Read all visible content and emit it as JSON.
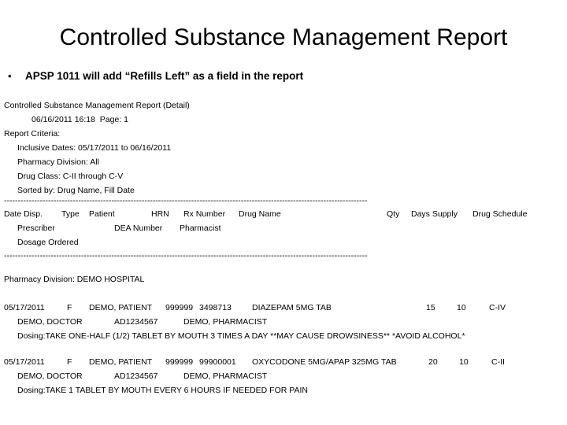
{
  "slide": {
    "title": "Controlled Substance Management Report",
    "bullet_mark": "•",
    "bullet_text": "APSP 1011 will add “Refills Left” as a field in the report"
  },
  "report": {
    "heading": "Controlled Substance Management Report (Detail)",
    "run_stamp": "06/16/2011 16:18  Page: 1",
    "criteria_label": "Report Criteria:",
    "criteria": [
      "Inclusive Dates: 05/17/2011 to 06/16/2011",
      "Pharmacy Division: All",
      "Drug Class: C-II through C-V",
      "Sorted by: Drug Name, Fill Date"
    ],
    "separator": "------------------------------------------------------------------------------------------------------------------------------------",
    "columns": {
      "date_disp": "Date Disp.",
      "type": "Type",
      "patient": "Patient",
      "hrn": "HRN",
      "rx_number": "Rx Number",
      "drug_name": "Drug Name",
      "qty": "Qty",
      "days_supply": "Days Supply",
      "drug_schedule": "Drug Schedule",
      "prescriber": "Prescriber",
      "dea_number": "DEA Number",
      "pharmacist": "Pharmacist",
      "dosage_ordered": "Dosage Ordered"
    },
    "division_line": "Pharmacy Division: DEMO HOSPITAL",
    "records": [
      {
        "date_disp": "05/17/2011",
        "type": "F",
        "patient": "DEMO, PATIENT",
        "hrn": "999999",
        "rx_number": "3498713",
        "drug_name": "DIAZEPAM 5MG TAB",
        "qty": "15",
        "days_supply": "10",
        "drug_schedule": "C-IV",
        "prescriber": "DEMO, DOCTOR",
        "dea_number": "AD1234567",
        "pharmacist": "DEMO, PHARMACIST",
        "dosing": "Dosing:TAKE ONE-HALF (1/2) TABLET BY MOUTH 3 TIMES A DAY **MAY CAUSE DROWSINESS** *AVOID ALCOHOL*"
      },
      {
        "date_disp": "05/17/2011",
        "type": "F",
        "patient": "DEMO, PATIENT",
        "hrn": "999999",
        "rx_number": "99900001",
        "drug_name": "OXYCODONE 5MG/APAP 325MG TAB",
        "qty": "20",
        "days_supply": "10",
        "drug_schedule": "C-II",
        "prescriber": "DEMO, DOCTOR",
        "dea_number": "AD1234567",
        "pharmacist": "DEMO, PHARMACIST",
        "dosing": "Dosing:TAKE 1 TABLET BY MOUTH EVERY 6 HOURS IF NEEDED FOR PAIN"
      }
    ]
  }
}
